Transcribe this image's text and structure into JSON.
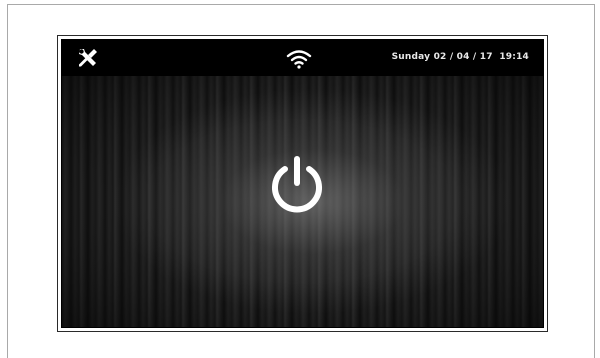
{
  "status_bar": {
    "settings_icon": "tools-icon",
    "wifi_icon": "wifi-icon",
    "day": "Sunday",
    "date": "02 / 04 / 17",
    "time": "19:14"
  },
  "main": {
    "power_icon": "power-icon",
    "background": "dark-wood-texture"
  },
  "colors": {
    "screen_bg": "#000000",
    "text": "#e8e8e8",
    "icon": "#ffffff"
  }
}
